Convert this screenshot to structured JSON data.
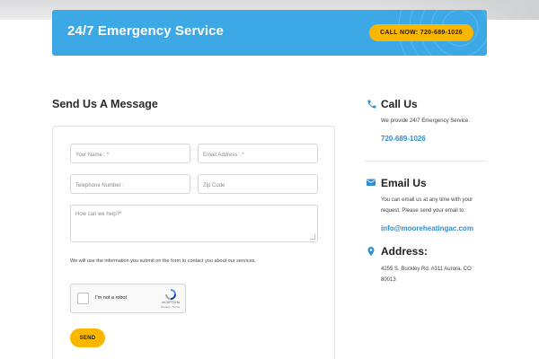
{
  "banner": {
    "title": "24/7 Emergency Service",
    "call_label": "CALL NOW: 720-689-1026"
  },
  "form": {
    "heading": "Send Us A Message",
    "name_placeholder": "Your Name : *",
    "email_placeholder": "Email Address : *",
    "phone_placeholder": "Telephone Number :",
    "zip_placeholder": "Zip Code",
    "message_placeholder": "How can we help?*",
    "disclaimer": "We will use the information you submit on the form to contact you about our services.",
    "captcha": {
      "label": "I'm not a robot",
      "brand": "reCAPTCHA",
      "terms": "Privacy - Terms"
    },
    "send_label": "SEND"
  },
  "contact": {
    "call": {
      "title": "Call Us",
      "text": "We provide 24/7 Emergency Service.",
      "phone": "720-689-1026",
      "icon": "phone-icon"
    },
    "email": {
      "title": "Email Us",
      "text_line1": "You can email us at any time with your",
      "text_line2": "request. Please send your email to:",
      "address": "info@mooreheatingac.com",
      "icon": "envelope-icon"
    },
    "address": {
      "title": "Address:",
      "line1": "4255 S. Buckley Rd. #311 Aurora, CO",
      "line2": "80013",
      "icon": "map-pin-icon"
    }
  },
  "colors": {
    "banner_blue": "#3da8e6",
    "accent_yellow": "#f9b700",
    "link_blue": "#2d8fd0"
  }
}
